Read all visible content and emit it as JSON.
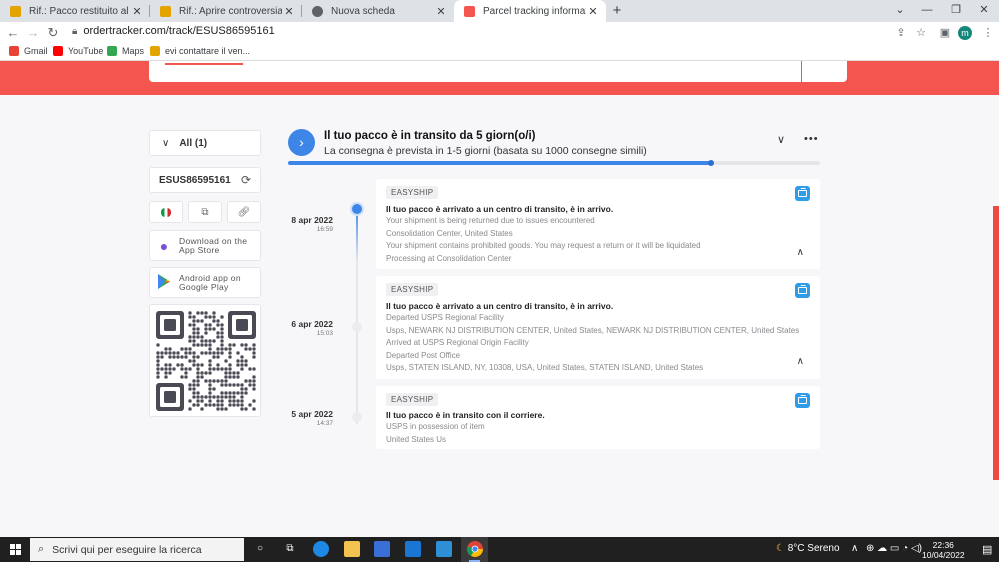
{
  "browser": {
    "tabs": [
      {
        "title": "Rif.: Pacco restituito al mittente -",
        "close": "✕",
        "favicon_color": "#e3a400"
      },
      {
        "title": "Rif.: Aprire controversia dopo av",
        "close": "✕",
        "favicon_color": "#e3a400"
      },
      {
        "title": "Nuova scheda",
        "close": "✕",
        "favicon_color": "#5f6368"
      },
      {
        "title": "Parcel tracking information",
        "close": "✕",
        "favicon_color": "#f4564f"
      }
    ],
    "new_tab": "+",
    "window_controls": {
      "min": "⌄",
      "minimize": "—",
      "restore": "❐",
      "close": "✕"
    },
    "url": "ordertracker.com/track/ESUS86595161",
    "profile_initial": "m",
    "bookmarks": [
      {
        "label": "Gmail",
        "color": "#ea4335"
      },
      {
        "label": "YouTube",
        "color": "#ff0000"
      },
      {
        "label": "Maps",
        "color": "#34a853"
      },
      {
        "label": "evi contattare il ven...",
        "color": "#e3a400"
      }
    ]
  },
  "sidebar": {
    "filter_label": "All (1)",
    "tracking_number": "ESUS86595161",
    "app_store": {
      "line1": "Download on the",
      "line2": "App Store"
    },
    "google_play": {
      "line1": "Android app on",
      "line2": "Google Play"
    }
  },
  "status": {
    "title": "Il tuo pacco è in transito da 5 giorn(o/i)",
    "subtitle": "La consegna è prevista in 1-5 giorni (basata su 1000 consegne simili)",
    "progress": 0.796,
    "menu": "•••"
  },
  "events": [
    {
      "date": "8 apr 2022",
      "time": "16:59",
      "carrier": "EASYSHIP",
      "headline": "Il tuo pacco è arrivato a un centro di transito, è in arrivo.",
      "lines": [
        "Your shipment is being returned due to issues encountered",
        "Consolidation Center, United States",
        "Your shipment contains prohibited goods. You may request a return or it will be liquidated",
        "Processing at Consolidation Center"
      ]
    },
    {
      "date": "6 apr 2022",
      "time": "15:03",
      "carrier": "EASYSHIP",
      "headline": "Il tuo pacco è arrivato a un centro di transito, è in arrivo.",
      "lines": [
        "Departed USPS Regional Facility",
        "Usps, NEWARK NJ DISTRIBUTION CENTER, United States, NEWARK NJ DISTRIBUTION CENTER, United States",
        "Arrived at USPS Regional Origin Facility",
        "Departed Post Office",
        "Usps, STATEN ISLAND, NY, 10308, USA, United States, STATEN ISLAND, United States"
      ]
    },
    {
      "date": "5 apr 2022",
      "time": "14:37",
      "carrier": "EASYSHIP",
      "headline": "Il tuo pacco è in transito con il corriere.",
      "lines": [
        "USPS in possession of item",
        "United States Us"
      ]
    }
  ],
  "taskbar": {
    "search_placeholder": "Scrivi qui per eseguire la ricerca",
    "weather": "8°C  Sereno",
    "time": "22:36",
    "date": "10/04/2022"
  },
  "colors": {
    "brand_red": "#f4564f",
    "accent_blue": "#3d86e8"
  }
}
